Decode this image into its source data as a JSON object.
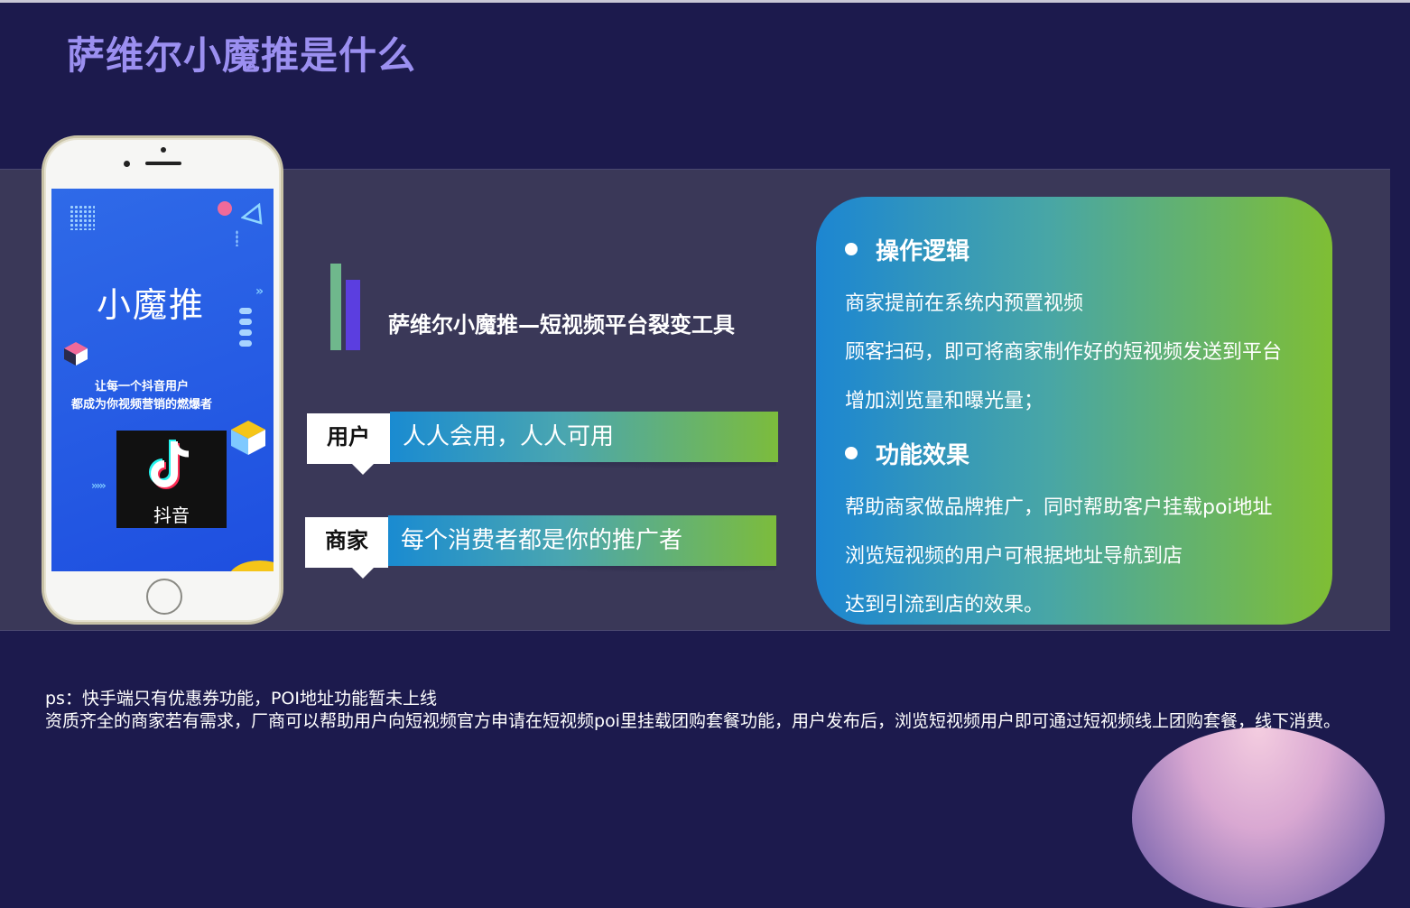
{
  "page": {
    "title": "萨维尔小魔推是什么"
  },
  "phone": {
    "screen_title": "小魔推",
    "slogan_line1": "让每一个抖音用户",
    "slogan_line2": "都成为你视频营销的燃爆者",
    "app_name": "抖音",
    "colors": {
      "screen": "#2f6ae8",
      "accent_pink": "#f06a9a",
      "accent_yellow": "#f5c518"
    }
  },
  "middle": {
    "tool_title": "萨维尔小魔推—短视频平台裂变工具",
    "rows": [
      {
        "tag": "用户",
        "text": "人人会用，人人可用"
      },
      {
        "tag": "商家",
        "text": "每个消费者都是你的推广者"
      }
    ]
  },
  "card": {
    "section1": {
      "heading": "操作逻辑",
      "lines": [
        "商家提前在系统内预置视频",
        "顾客扫码，即可将商家制作好的短视频发送到平台",
        "增加浏览量和曝光量；"
      ]
    },
    "section2": {
      "heading": "功能效果",
      "lines": [
        "帮助商家做品牌推广，同时帮助客户挂载poi地址",
        "浏览短视频的用户可根据地址导航到店",
        "达到引流到店的效果。"
      ]
    },
    "colors": {
      "start": "#1c86d2",
      "end": "#7fbe34"
    }
  },
  "notes": {
    "line1": "ps：快手端只有优惠券功能，POI地址功能暂未上线",
    "line2": "资质齐全的商家若有需求，厂商可以帮助用户向短视频官方申请在短视频poi里挂载团购套餐功能，用户发布后，浏览短视频用户即可通过短视频线上团购套餐，线下消费。"
  }
}
